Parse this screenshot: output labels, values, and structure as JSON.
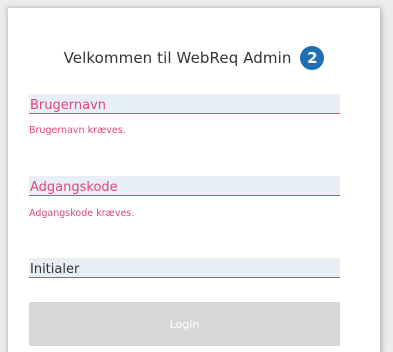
{
  "form": {
    "title": "Velkommen til WebReq Admin",
    "badge": "2",
    "username": {
      "placeholder": "Brugernavn",
      "value": "",
      "error": "Brugernavn kræves."
    },
    "password": {
      "placeholder": "Adgangskode",
      "value": "",
      "error": "Adgangskode kræves."
    },
    "initials": {
      "placeholder": "Initialer",
      "value": ""
    },
    "login_label": "Login"
  },
  "colors": {
    "error": "#e0457b",
    "badge": "#1f6fb5",
    "field_bg": "#e8eef6",
    "button_disabled": "#d8d8d8"
  }
}
